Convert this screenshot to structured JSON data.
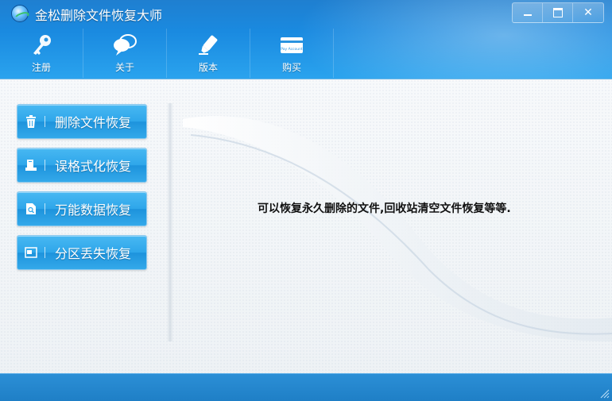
{
  "app": {
    "title": "金松删除文件恢复大师"
  },
  "window_controls": {
    "close_glyph": "✕"
  },
  "toolbar": [
    {
      "label": "注册",
      "icon": "key-icon"
    },
    {
      "label": "关于",
      "icon": "chat-bubbles-icon"
    },
    {
      "label": "版本",
      "icon": "marker-pen-icon"
    },
    {
      "label": "购买",
      "icon": "credit-card-icon",
      "icon_text": "Pay Account"
    }
  ],
  "sidebar": {
    "items": [
      {
        "label": "删除文件恢复",
        "icon": "trash-icon"
      },
      {
        "label": "误格式化恢复",
        "icon": "drive-icon"
      },
      {
        "label": "万能数据恢复",
        "icon": "document-search-icon"
      },
      {
        "label": "分区丢失恢复",
        "icon": "partition-icon"
      }
    ]
  },
  "main": {
    "description": "可以恢复永久删除的文件,回收站清空文件恢复等等."
  },
  "colors": {
    "header": "#1a8ae0",
    "button": "#2ea6ea",
    "status": "#1f7fc6"
  }
}
